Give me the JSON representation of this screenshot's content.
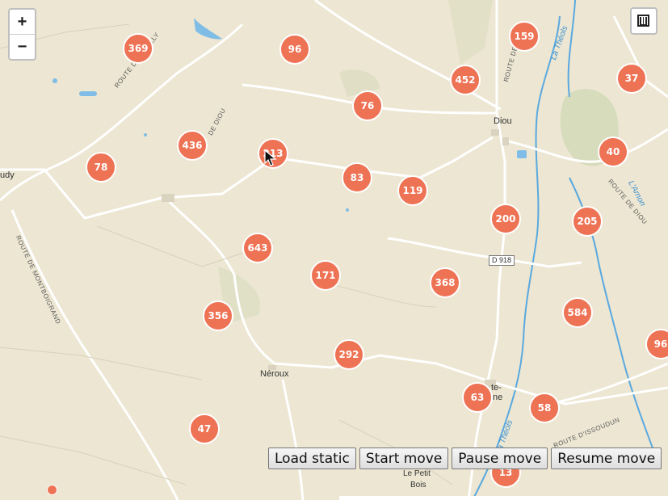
{
  "controls": {
    "zoom_in": "+",
    "zoom_out": "−"
  },
  "clusters": [
    {
      "count": "369"
    },
    {
      "count": "96"
    },
    {
      "count": "159"
    },
    {
      "count": "452"
    },
    {
      "count": "37"
    },
    {
      "count": "76"
    },
    {
      "count": "436"
    },
    {
      "count": "213"
    },
    {
      "count": "78"
    },
    {
      "count": "83"
    },
    {
      "count": "119"
    },
    {
      "count": "40"
    },
    {
      "count": "200"
    },
    {
      "count": "205"
    },
    {
      "count": "643"
    },
    {
      "count": "171"
    },
    {
      "count": "368"
    },
    {
      "count": "356"
    },
    {
      "count": "584"
    },
    {
      "count": "96"
    },
    {
      "count": "292"
    },
    {
      "count": "63"
    },
    {
      "count": "58"
    },
    {
      "count": "47"
    },
    {
      "count": "13"
    }
  ],
  "map_labels": {
    "route_reuilly": "ROUTE DE REUILLY",
    "route_diou_w": "DE DIOU",
    "route_montboigrand": "ROUTE DE MONTBOIGRAND",
    "route_de": "ROUTE DE",
    "route_diou_e": "ROUTE DE DIOU",
    "route_issoudun": "ROUTE D'ISSOUDUN",
    "river_theols_n": "La Théols",
    "river_theols_s": "La Théols",
    "river_arnon": "L'Arnon",
    "place_diou": "Diou",
    "place_neroux": "Néroux",
    "place_le_petit_bois_1": "Le Petit",
    "place_le_petit_bois_2": "Bois",
    "place_audy": "udy",
    "place_ste_1": "te-",
    "place_ste_2": "ne",
    "road_shield": "D 918"
  },
  "buttons": {
    "load_static": "Load static",
    "start_move": "Start move",
    "pause_move": "Pause move",
    "resume_move": "Resume move"
  },
  "colors": {
    "cluster_fill": "#ee7355",
    "map_background": "#ece6d2",
    "river": "#5aa9e0"
  }
}
